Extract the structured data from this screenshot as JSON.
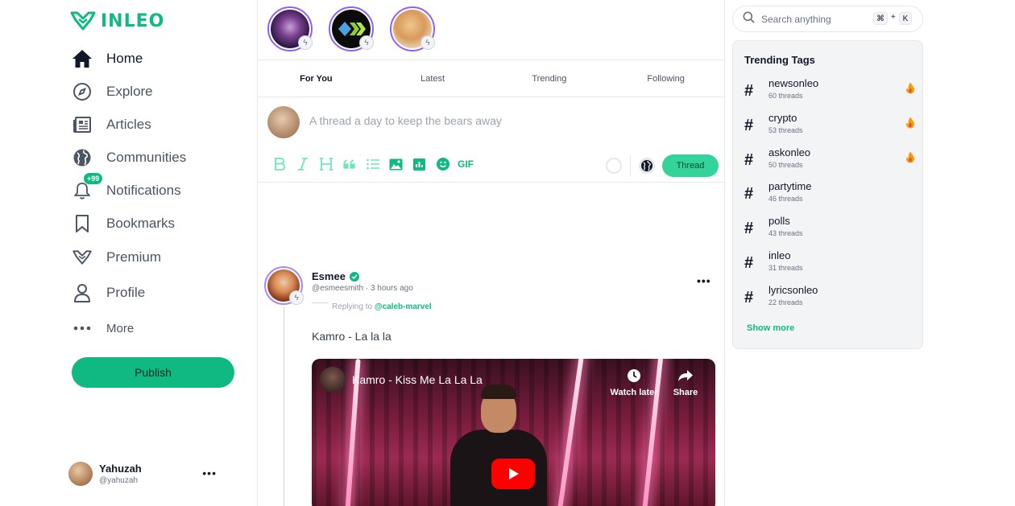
{
  "brand": {
    "name": "INLEO",
    "color": "#10b981"
  },
  "nav": {
    "items": [
      {
        "label": "Home",
        "icon": "home-icon"
      },
      {
        "label": "Explore",
        "icon": "compass-icon"
      },
      {
        "label": "Articles",
        "icon": "newspaper-icon"
      },
      {
        "label": "Communities",
        "icon": "globe-icon"
      },
      {
        "label": "Notifications",
        "icon": "bell-icon",
        "badge": "+99"
      },
      {
        "label": "Bookmarks",
        "icon": "bookmark-icon"
      },
      {
        "label": "Premium",
        "icon": "leo-logo-icon"
      },
      {
        "label": "Profile",
        "icon": "user-icon"
      },
      {
        "label": "More",
        "icon": "dots-icon"
      }
    ],
    "publish_label": "Publish"
  },
  "current_user": {
    "name": "Yahuzah",
    "handle": "@yahuzah"
  },
  "feed": {
    "tabs": [
      "For You",
      "Latest",
      "Trending",
      "Following"
    ],
    "active_tab": "For You",
    "composer": {
      "placeholder": "A thread a day to keep the bears away",
      "gif_label": "GIF",
      "submit_label": "Thread"
    },
    "post": {
      "author": "Esmee",
      "handle": "@esmeesmith",
      "time": "3 hours ago",
      "meta": "@esmeesmith · 3 hours ago",
      "replying_prefix": "Replying to",
      "replying_to": "@caleb-marvel",
      "body": "Kamro - La la la",
      "video": {
        "title": "Kamro - Kiss Me La La La",
        "watch_later": "Watch later",
        "share": "Share"
      }
    }
  },
  "search": {
    "placeholder": "Search anything",
    "shortcut_mod": "⌘",
    "shortcut_plus": "+",
    "shortcut_key": "K"
  },
  "trending": {
    "title": "Trending Tags",
    "tags": [
      {
        "name": "newsonleo",
        "count": "60 threads",
        "hot": true
      },
      {
        "name": "crypto",
        "count": "53 threads",
        "hot": true
      },
      {
        "name": "askonleo",
        "count": "50 threads",
        "hot": true
      },
      {
        "name": "partytime",
        "count": "46 threads",
        "hot": false
      },
      {
        "name": "polls",
        "count": "43 threads",
        "hot": false
      },
      {
        "name": "inleo",
        "count": "31 threads",
        "hot": false
      },
      {
        "name": "lyricsonleo",
        "count": "22 threads",
        "hot": false
      }
    ],
    "show_more": "Show more"
  }
}
